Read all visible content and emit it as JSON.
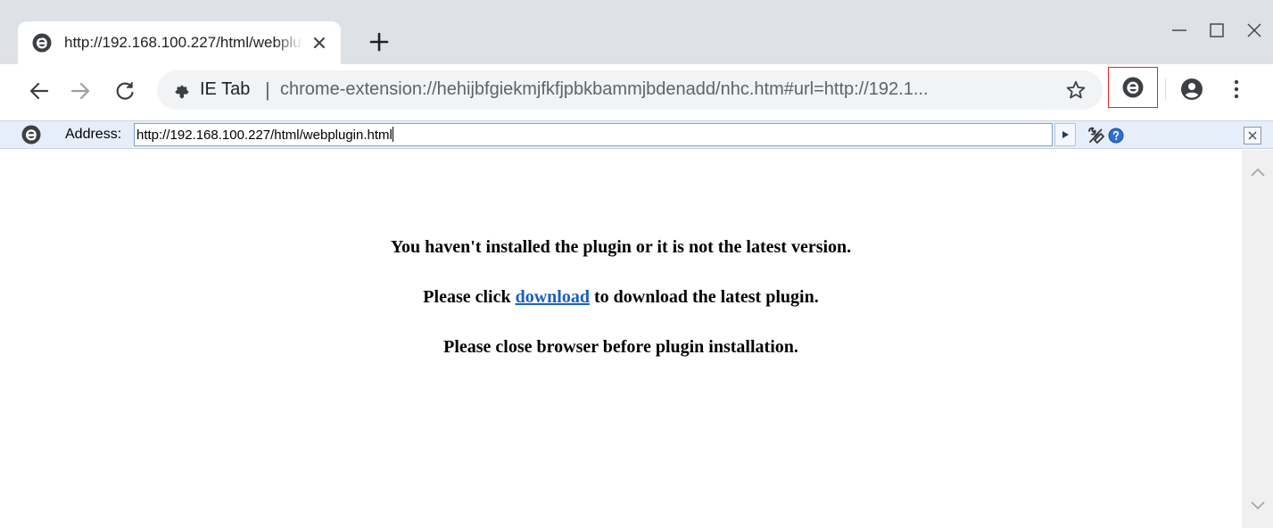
{
  "tab": {
    "title": "http://192.168.100.227/html/webplugin.html",
    "favicon": "ie-tab-icon",
    "close": "close-icon",
    "new_tab": "plus-icon"
  },
  "window_controls": [
    "minimize-icon",
    "maximize-icon",
    "close-icon"
  ],
  "toolbar": {
    "back": "back-arrow-icon",
    "forward": "forward-arrow-icon",
    "reload": "reload-icon",
    "extension_chip": "IE Tab",
    "url": "chrome-extension://hehijbfgiekmjfkfjpbkbammjbdenadd/nhc.htm#url=http://192.1...",
    "bookmark": "star-icon",
    "extension_icon": "ie-tab-icon",
    "profile": "profile-icon",
    "menu": "more-vert-icon"
  },
  "iebar": {
    "label": "Address:",
    "address": "http://192.168.100.227/html/webplugin.html"
  },
  "content": {
    "line1": "You haven't installed the plugin or it is not the latest version.",
    "line2_before": "Please click ",
    "line2_link": "download",
    "line2_after": " to download the latest plugin.",
    "line3": "Please close browser before plugin installation."
  },
  "colors": {
    "tabstrip_bg": "#dee1e6",
    "omnibox_bg": "#f1f3f4",
    "iebar_bg": "#e6eef9",
    "highlight_border": "#e8242c",
    "link": "#1a5fbf"
  }
}
